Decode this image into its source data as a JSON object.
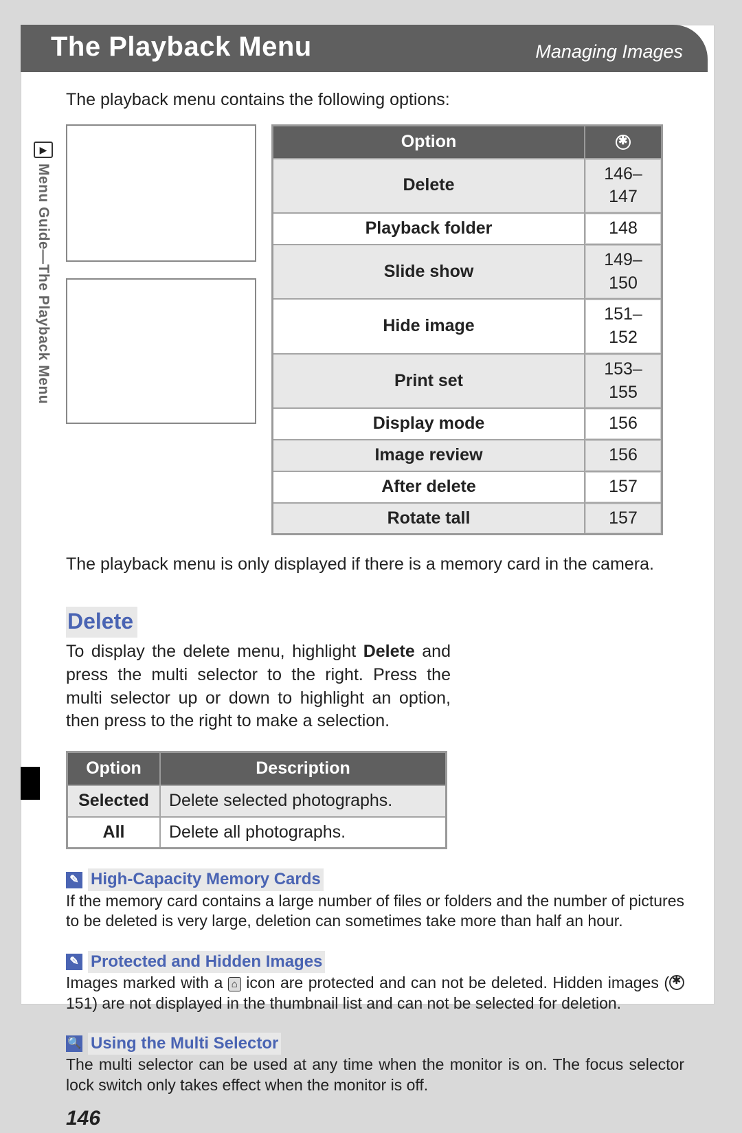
{
  "header": {
    "title": "The Playback Menu",
    "subtitle": "Managing Images"
  },
  "sidebar": {
    "text": "Menu Guide—The Playback Menu"
  },
  "intro": "The playback menu contains the following options:",
  "menu_table": {
    "headers": {
      "option": "Option",
      "page_icon_alt": "page"
    },
    "rows": [
      {
        "option": "Delete",
        "pages": "146–147",
        "shade": true
      },
      {
        "option": "Playback folder",
        "pages": "148",
        "shade": false
      },
      {
        "option": "Slide show",
        "pages": "149–150",
        "shade": true
      },
      {
        "option": "Hide image",
        "pages": "151–152",
        "shade": false
      },
      {
        "option": "Print set",
        "pages": "153–155",
        "shade": true
      },
      {
        "option": "Display mode",
        "pages": "156",
        "shade": false
      },
      {
        "option": "Image review",
        "pages": "156",
        "shade": true
      },
      {
        "option": "After delete",
        "pages": "157",
        "shade": false
      },
      {
        "option": "Rotate tall",
        "pages": "157",
        "shade": true
      }
    ]
  },
  "after_table": "The playback menu is only displayed if there is a memory card in the camera.",
  "delete": {
    "heading": "Delete",
    "para_pre": "To display the delete menu, highlight ",
    "para_bold": "Delete",
    "para_post": " and press the multi selector to the right.  Press the multi selector up or down to highlight an option, then press to the right to make a selection.",
    "table": {
      "headers": {
        "option": "Option",
        "desc": "Description"
      },
      "rows": [
        {
          "option": "Selected",
          "desc": "Delete selected photographs.",
          "shade": true
        },
        {
          "option": "All",
          "desc": "Delete all photographs.",
          "shade": false
        }
      ]
    }
  },
  "notes": {
    "hc": {
      "title": "High-Capacity Memory Cards",
      "body": "If the memory card contains a large number of files or folders and the number of pictures to be deleted is very large, deletion can sometimes take more than half an hour."
    },
    "ph": {
      "title": "Protected and Hidden Images",
      "body_pre": "Images marked with a ",
      "body_mid": " icon are protected and can not be deleted.  Hidden images (",
      "body_ref": " 151) are not displayed in the thumbnail list and can not be selected for deletion."
    },
    "ms": {
      "title": "Using the Multi Selector",
      "body": "The multi selector can be used at any time when the monitor is on.  The focus selector lock switch only takes effect when the monitor is off."
    }
  },
  "page_number": "146"
}
